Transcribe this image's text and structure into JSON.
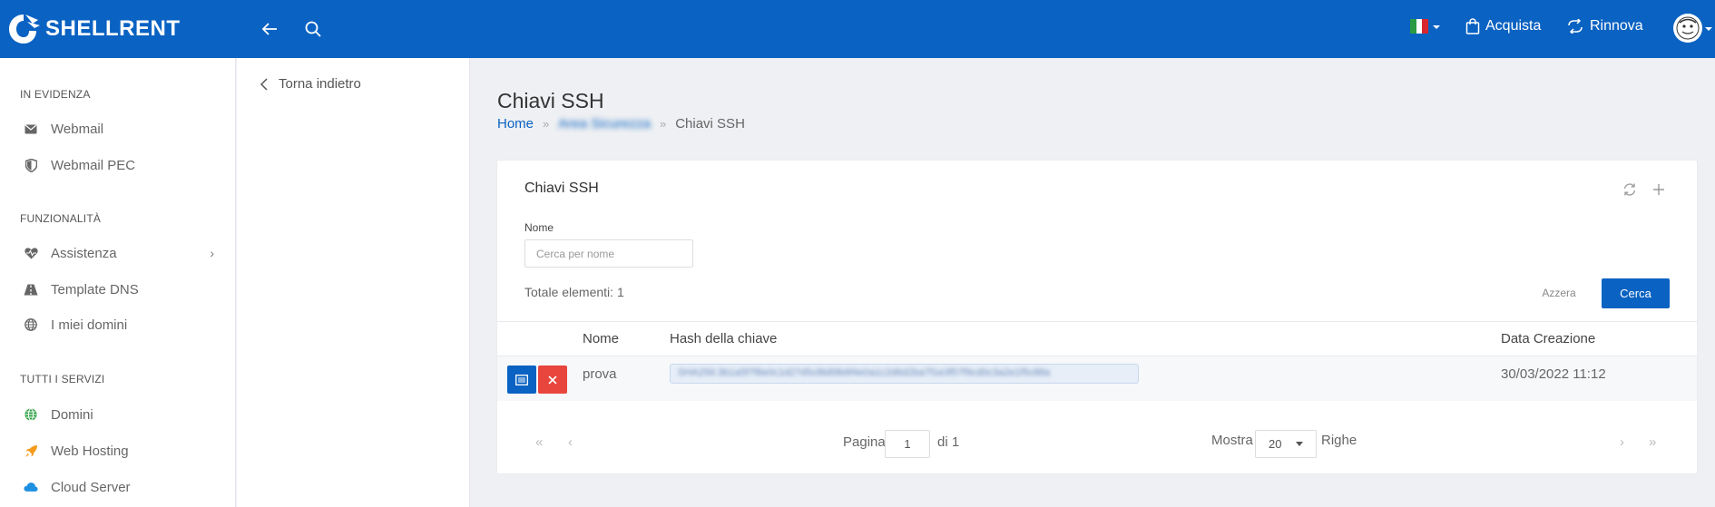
{
  "header": {
    "brand": "SHELLRENT",
    "buy_label": "Acquista",
    "renew_label": "Rinnova",
    "accent_color": "#0a62c2"
  },
  "sidebar": {
    "section_featured": "IN EVIDENZA",
    "section_features": "FUNZIONALITÀ",
    "section_services": "TUTTI I SERVIZI",
    "items": [
      {
        "label": "Webmail",
        "icon": "mail-icon"
      },
      {
        "label": "Webmail PEC",
        "icon": "shield-icon"
      },
      {
        "label": "Assistenza",
        "icon": "heart-pulse-icon"
      },
      {
        "label": "Template DNS",
        "icon": "road-icon"
      },
      {
        "label": "I miei domini",
        "icon": "globe-icon"
      },
      {
        "label": "Domini",
        "icon": "globe-green-icon"
      },
      {
        "label": "Web Hosting",
        "icon": "rocket-icon"
      },
      {
        "label": "Cloud Server",
        "icon": "cloud-icon"
      }
    ]
  },
  "subnav": {
    "back_label": "Torna indietro"
  },
  "page": {
    "title": "Chiavi SSH",
    "breadcrumb": {
      "home": "Home",
      "middle": "Area Sicurezza",
      "current": "Chiavi SSH"
    }
  },
  "card": {
    "title": "Chiavi SSH",
    "filter_label": "Nome",
    "filter_placeholder": "Cerca per nome",
    "total": "Totale elementi: 1",
    "reset_label": "Azzera",
    "search_label": "Cerca",
    "columns": {
      "name": "Nome",
      "hash": "Hash della chiave",
      "created": "Data Creazione"
    },
    "rows": [
      {
        "name": "prova",
        "hash": "SHA256:3b1a5f7f8e0c1d27d5c8b89b6f4e0a1c2d6d2ba7f1e3f57f9cd0c3a2e1f5c88a",
        "created": "30/03/2022 11:12"
      }
    ],
    "pagination": {
      "first": "«",
      "prev": "‹",
      "next": "›",
      "last": "»",
      "page_label": "Pagina",
      "page_value": "1",
      "of_label": "di 1",
      "show_label": "Mostra",
      "rows_value": "20",
      "rows_label": "Righe"
    }
  }
}
